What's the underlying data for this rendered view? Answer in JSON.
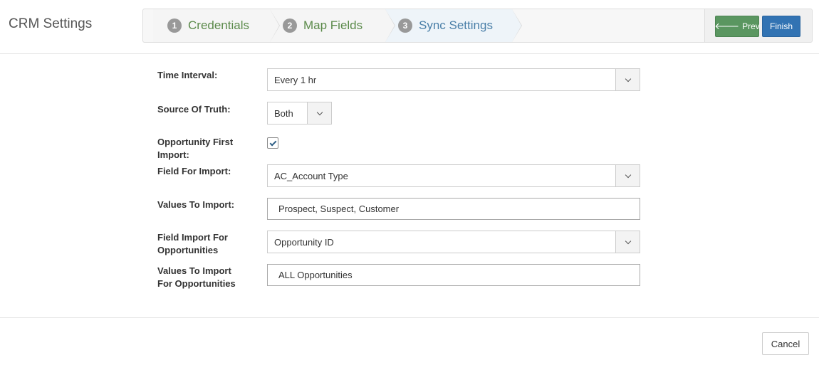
{
  "header": {
    "title": "CRM Settings"
  },
  "wizard": {
    "steps": [
      {
        "number": "1",
        "label": "Credentials"
      },
      {
        "number": "2",
        "label": "Map Fields"
      },
      {
        "number": "3",
        "label": "Sync Settings"
      }
    ],
    "prev_label": "Prev",
    "finish_label": "Finish"
  },
  "form": {
    "time_interval": {
      "label": "Time Interval:",
      "value": "Every 1 hr"
    },
    "source_of_truth": {
      "label": "Source Of Truth:",
      "value": "Both"
    },
    "opportunity_first_import": {
      "label": "Opportunity First Import:",
      "checked": true
    },
    "field_for_import": {
      "label": "Field For Import:",
      "value": "AC_Account Type"
    },
    "values_to_import": {
      "label": "Values To Import:",
      "value": "Prospect, Suspect, Customer"
    },
    "field_import_for_opportunities": {
      "label": "Field Import For Opportunities",
      "value": "Opportunity ID"
    },
    "values_to_import_for_opportunities": {
      "label": "Values To Import For Opportunities",
      "value": "ALL Opportunities"
    }
  },
  "footer": {
    "cancel_label": "Cancel"
  },
  "colors": {
    "prev_button": "#5a9660",
    "finish_button": "#3273b3",
    "step_text": "#5b8a4a",
    "active_step_text": "#4a7fa8"
  },
  "icons": {
    "prev": "arrow-left-icon",
    "dropdown": "chevron-down-icon",
    "checkbox": "check-icon"
  }
}
